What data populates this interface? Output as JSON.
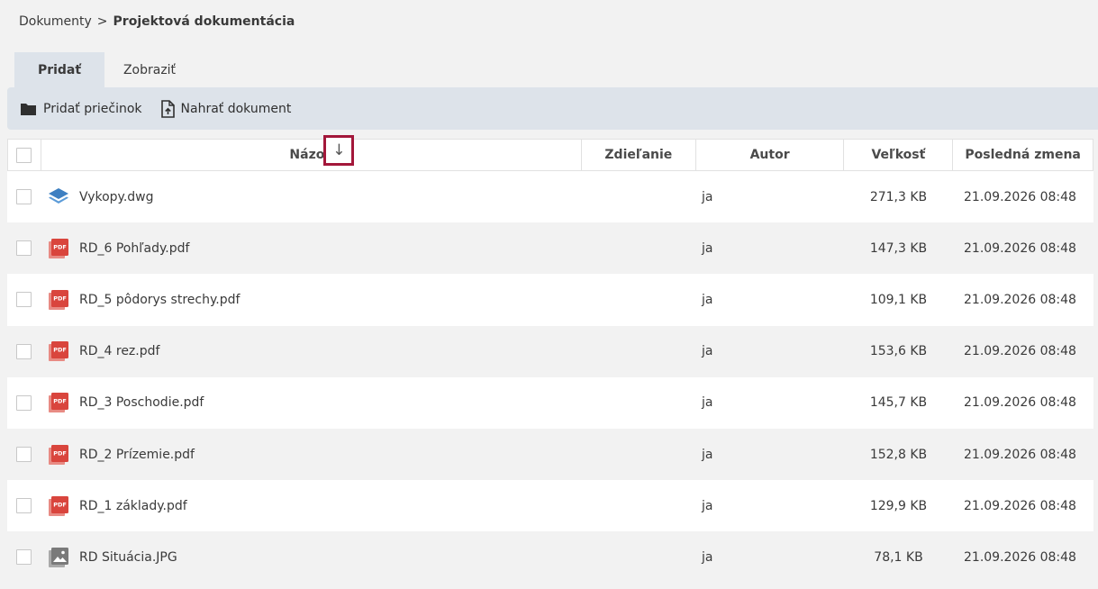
{
  "breadcrumb": {
    "root": "Dokumenty",
    "separator": ">",
    "current": "Projektová dokumentácia"
  },
  "tabs": [
    {
      "label": "Pridať",
      "active": true
    },
    {
      "label": "Zobraziť",
      "active": false
    }
  ],
  "toolbar": {
    "add_folder": "Pridať priečinok",
    "upload_document": "Nahrať dokument"
  },
  "table": {
    "columns": {
      "name": "Názov",
      "sharing": "Zdieľanie",
      "author": "Autor",
      "size": "Veľkosť",
      "modified": "Posledná zmena"
    },
    "sort_indicator": "↓",
    "rows": [
      {
        "icon": "layers-icon",
        "name": "Vykopy.dwg",
        "sharing": "",
        "author": "ja",
        "size": "271,3 KB",
        "modified": "21.09.2026 08:48"
      },
      {
        "icon": "pdf-icon",
        "name": "RD_6 Pohľady.pdf",
        "sharing": "",
        "author": "ja",
        "size": "147,3 KB",
        "modified": "21.09.2026 08:48"
      },
      {
        "icon": "pdf-icon",
        "name": "RD_5 pôdorys strechy.pdf",
        "sharing": "",
        "author": "ja",
        "size": "109,1 KB",
        "modified": "21.09.2026 08:48"
      },
      {
        "icon": "pdf-icon",
        "name": "RD_4 rez.pdf",
        "sharing": "",
        "author": "ja",
        "size": "153,6 KB",
        "modified": "21.09.2026 08:48"
      },
      {
        "icon": "pdf-icon",
        "name": "RD_3 Poschodie.pdf",
        "sharing": "",
        "author": "ja",
        "size": "145,7 KB",
        "modified": "21.09.2026 08:48"
      },
      {
        "icon": "pdf-icon",
        "name": "RD_2 Prízemie.pdf",
        "sharing": "",
        "author": "ja",
        "size": "152,8 KB",
        "modified": "21.09.2026 08:48"
      },
      {
        "icon": "pdf-icon",
        "name": "RD_1 základy.pdf",
        "sharing": "",
        "author": "ja",
        "size": "129,9 KB",
        "modified": "21.09.2026 08:48"
      },
      {
        "icon": "image-icon",
        "name": "RD Situácia.JPG",
        "sharing": "",
        "author": "ja",
        "size": "78,1 KB",
        "modified": "21.09.2026 08:48"
      }
    ]
  },
  "colors": {
    "accent_tab": "#dde3ea",
    "sort_highlight": "#a3173a",
    "pdf_red": "#d9453d",
    "layers_blue": "#3d7fc1",
    "image_gray": "#7a7a7a"
  }
}
